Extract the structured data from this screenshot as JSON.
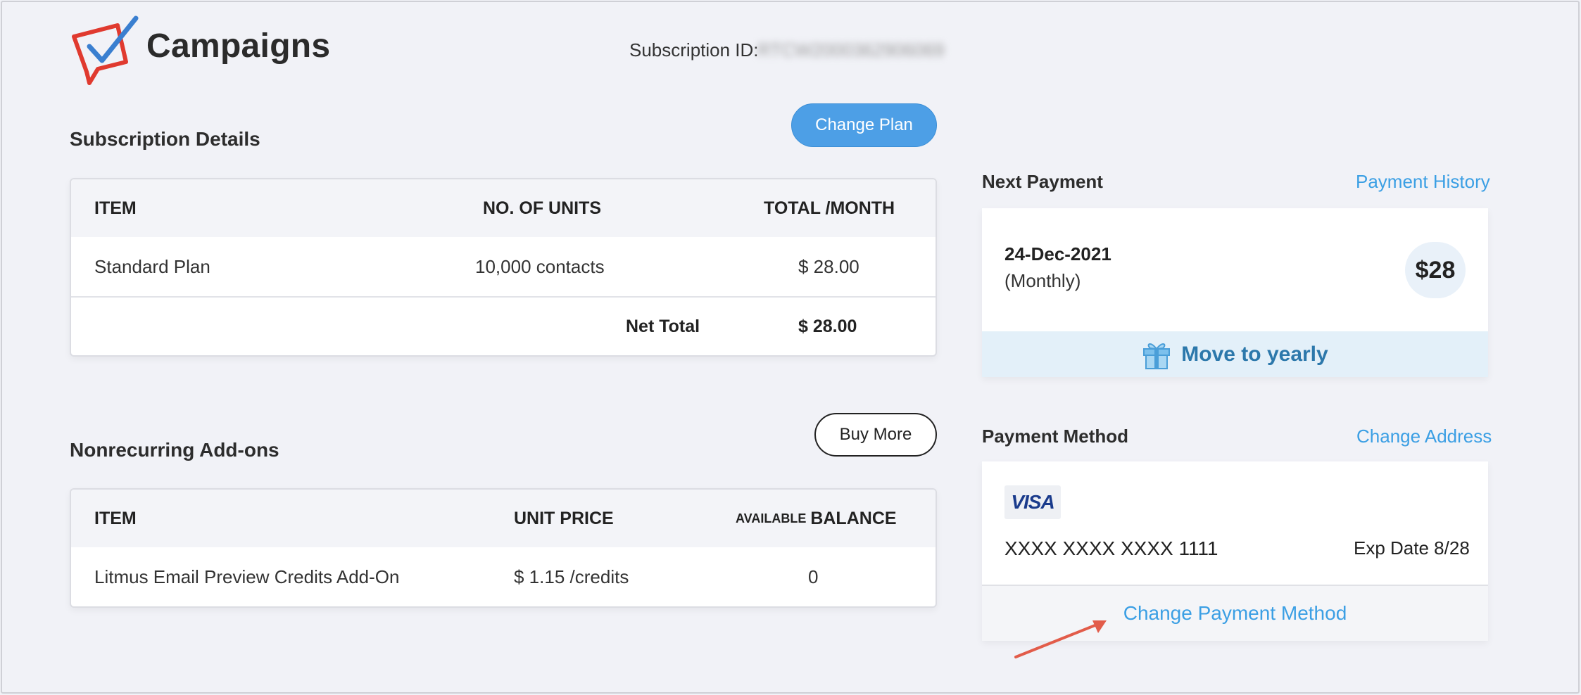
{
  "header": {
    "brand": "Campaigns",
    "subscription_id_label": "Subscription ID:",
    "subscription_id_value": "RTCW2000362906069"
  },
  "subscription": {
    "title": "Subscription Details",
    "change_plan_label": "Change Plan",
    "columns": [
      "ITEM",
      "NO. OF UNITS",
      "TOTAL /MONTH"
    ],
    "rows": [
      {
        "item": "Standard Plan",
        "units": "10,000 contacts",
        "total": "$ 28.00"
      }
    ],
    "net_total_label": "Net Total",
    "net_total_value": "$ 28.00"
  },
  "addons": {
    "title": "Nonrecurring Add-ons",
    "buy_more_label": "Buy More",
    "columns": [
      "ITEM",
      "UNIT PRICE",
      "BALANCE"
    ],
    "balance_prefix": "AVAILABLE",
    "rows": [
      {
        "item": "Litmus Email Preview Credits Add-On",
        "unit_price": "$ 1.15 /credits",
        "balance": "0"
      }
    ]
  },
  "next_payment": {
    "title": "Next Payment",
    "history_link": "Payment History",
    "date": "24-Dec-2021",
    "frequency": "(Monthly)",
    "amount": "$28",
    "yearly_label": "Move to yearly",
    "yearly_icon": "gift-icon"
  },
  "payment_method": {
    "title": "Payment Method",
    "change_address_link": "Change Address",
    "card_brand": "VISA",
    "card_number": "XXXX XXXX XXXX 1111",
    "exp_date": "Exp Date 8/28",
    "change_method_link": "Change Payment Method"
  },
  "colors": {
    "accent": "#4d9fe6",
    "link": "#3b9fe4",
    "yearly_text": "#2c78ab",
    "logo_red": "#e03a2f",
    "logo_blue": "#3a7fd0",
    "annotation_arrow": "#e25c4a"
  }
}
